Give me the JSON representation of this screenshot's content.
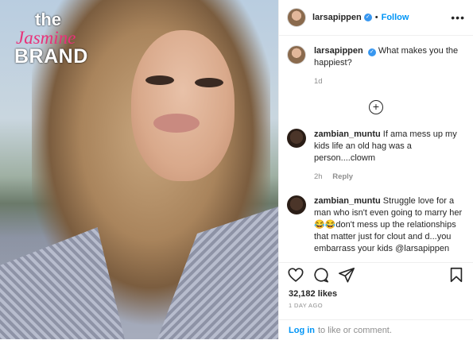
{
  "watermark": {
    "line1": "the",
    "line2": "Jasmine",
    "line3": "BRAND"
  },
  "header": {
    "username": "larsapippen",
    "verified_mark": "✓",
    "separator": "•",
    "follow_label": "Follow",
    "more_label": "•••"
  },
  "caption": {
    "username": "larsapippen",
    "text": "What makes you the happiest?",
    "age": "1d"
  },
  "load_more_label": "+",
  "comments": [
    {
      "username": "zambian_muntu",
      "text": "If ama mess up my kids life an old hag was a person....clowm",
      "age": "2h",
      "reply_label": "Reply"
    },
    {
      "username": "zambian_muntu",
      "text": "Struggle love for a man who isn't even going to marry her 😂😂don't mess up the relationships that matter just for clout and d...you embarrass your kids @larsapippen"
    }
  ],
  "actions": {
    "like_icon": "heart-icon",
    "comment_icon": "comment-icon",
    "share_icon": "share-icon",
    "save_icon": "bookmark-icon"
  },
  "likes": "32,182 likes",
  "timestamp": "1 DAY AGO",
  "login": {
    "link": "Log in",
    "rest": "to like or comment."
  },
  "colors": {
    "link": "#0095f6",
    "verified": "#3897f0",
    "muted": "#8e8e8e",
    "watermark_pink": "#e8327a"
  }
}
